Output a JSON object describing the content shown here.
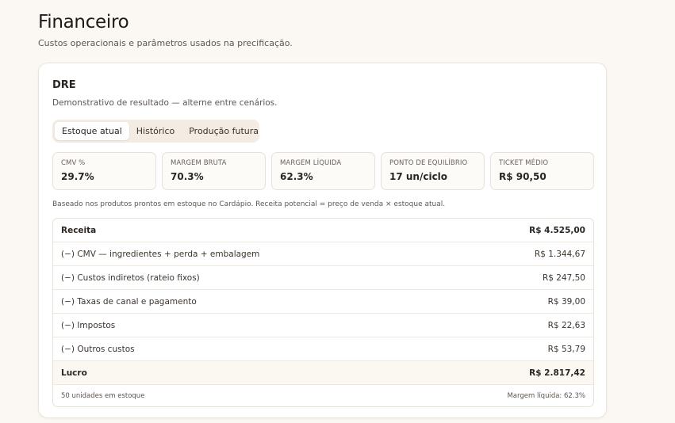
{
  "page": {
    "title": "Financeiro",
    "subtitle": "Custos operacionais e parâmetros usados na precificação."
  },
  "card": {
    "title": "DRE",
    "subtitle": "Demonstrativo de resultado — alterne entre cenários."
  },
  "tabs": [
    {
      "label": "Estoque atual",
      "active": true
    },
    {
      "label": "Histórico",
      "active": false
    },
    {
      "label": "Produção futura",
      "active": false
    }
  ],
  "kpis": [
    {
      "label": "CMV %",
      "value": "29.7%"
    },
    {
      "label": "Margem bruta",
      "value": "70.3%"
    },
    {
      "label": "Margem líquida",
      "value": "62.3%"
    },
    {
      "label": "Ponto de equilíbrio",
      "value": "17 un/ciclo"
    },
    {
      "label": "Ticket médio",
      "value": "R$ 90,50"
    }
  ],
  "note": "Baseado nos produtos prontos em estoque no Cardápio. Receita potencial = preço de venda × estoque atual.",
  "dre": {
    "rows": [
      {
        "label": "Receita",
        "value": "R$ 4.525,00"
      },
      {
        "label": "(−) CMV — ingredientes + perda + embalagem",
        "value": "R$ 1.344,67"
      },
      {
        "label": "(−) Custos indiretos (rateio fixos)",
        "value": "R$ 247,50"
      },
      {
        "label": "(−) Taxas de canal e pagamento",
        "value": "R$ 39,00"
      },
      {
        "label": "(−) Impostos",
        "value": "R$ 22,63"
      },
      {
        "label": "(−) Outros custos",
        "value": "R$ 53,79"
      },
      {
        "label": "Lucro",
        "value": "R$ 2.817,42"
      }
    ],
    "footer": {
      "left": "50 unidades em estoque",
      "right": "Margem líquida: 62.3%"
    }
  }
}
